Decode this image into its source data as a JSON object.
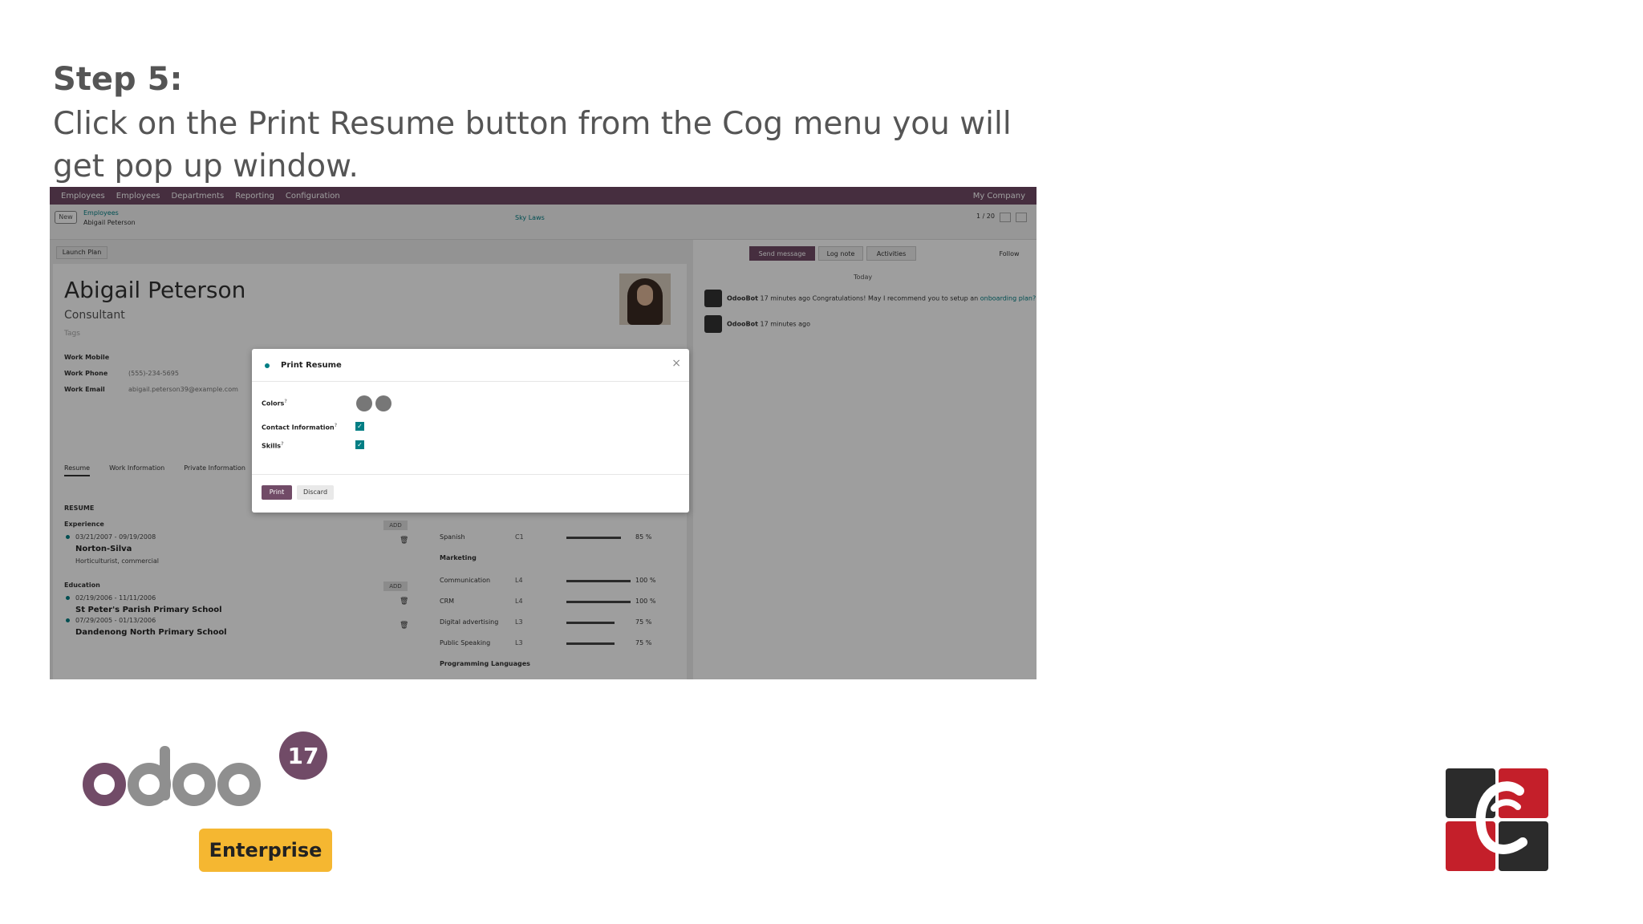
{
  "step": {
    "heading": "Step 5:",
    "description": "Click on the Print Resume button from the Cog menu you will get pop up window."
  },
  "screenshot": {
    "topnav": {
      "items": [
        "Employees",
        "Employees",
        "Departments",
        "Reporting",
        "Configuration"
      ],
      "right_text": "My Company"
    },
    "crumb": {
      "new": "New",
      "parent": "Employees",
      "current": "Abigail Peterson"
    },
    "sky_label": "Sky Laws",
    "pager": "1 / 20",
    "launch_plan": "Launch Plan",
    "employee": {
      "name": "Abigail Peterson",
      "job": "Consultant",
      "tags": "Tags",
      "fields": [
        {
          "label": "Work Mobile",
          "value": ""
        },
        {
          "label": "Work Phone",
          "value": "(555)-234-5695"
        },
        {
          "label": "Work Email",
          "value": "abigail.peterson39@example.com"
        }
      ],
      "tabs": [
        "Resume",
        "Work Information",
        "Private Information"
      ]
    },
    "resume": {
      "title": "RESUME",
      "experience_label": "Experience",
      "experience": [
        {
          "dates": "03/21/2007 - 09/19/2008",
          "title": "Norton-Silva",
          "detail": "Horticulturist, commercial"
        }
      ],
      "education_label": "Education",
      "education": [
        {
          "dates": "02/19/2006 - 11/11/2006",
          "title": "St Peter's Parish Primary School"
        },
        {
          "dates": "07/29/2005 - 01/13/2006",
          "title": "Dandenong North Primary School"
        }
      ],
      "add_label": "ADD"
    },
    "skills": [
      {
        "name": "Spanish",
        "level": "C1",
        "pct": "85 %",
        "fill": 0.85
      },
      {
        "section": "Marketing"
      },
      {
        "name": "Communication",
        "level": "L4",
        "pct": "100 %",
        "fill": 1.0
      },
      {
        "name": "CRM",
        "level": "L4",
        "pct": "100 %",
        "fill": 1.0
      },
      {
        "name": "Digital advertising",
        "level": "L3",
        "pct": "75 %",
        "fill": 0.75
      },
      {
        "name": "Public Speaking",
        "level": "L3",
        "pct": "75 %",
        "fill": 0.75
      },
      {
        "section": "Programming Languages"
      }
    ],
    "chatter": {
      "send_message": "Send message",
      "log_note": "Log note",
      "activities": "Activities",
      "follow": "Follow",
      "today": "Today",
      "messages": [
        {
          "author": "OdooBot",
          "time": "17 minutes ago",
          "text": "Congratulations! May I recommend you to setup an",
          "link": "onboarding plan?"
        },
        {
          "author": "OdooBot",
          "time": "17 minutes ago",
          "text": "",
          "link": ""
        }
      ]
    },
    "dialog": {
      "title": "Print Resume",
      "close": "×",
      "colors_label": "Colors",
      "contact_label": "Contact Information",
      "skills_label": "Skills",
      "help": "?",
      "print": "Print",
      "discard": "Discard"
    }
  },
  "logos": {
    "odoo_version": "17",
    "odoo_edition": "Enterprise",
    "colors": {
      "odoo_purple": "#714B67",
      "odoo_grey": "#8f8f8f",
      "enterprise_yellow": "#f5b731",
      "cg_red": "#c41f2a",
      "cg_dark": "#2b2b2b"
    }
  }
}
